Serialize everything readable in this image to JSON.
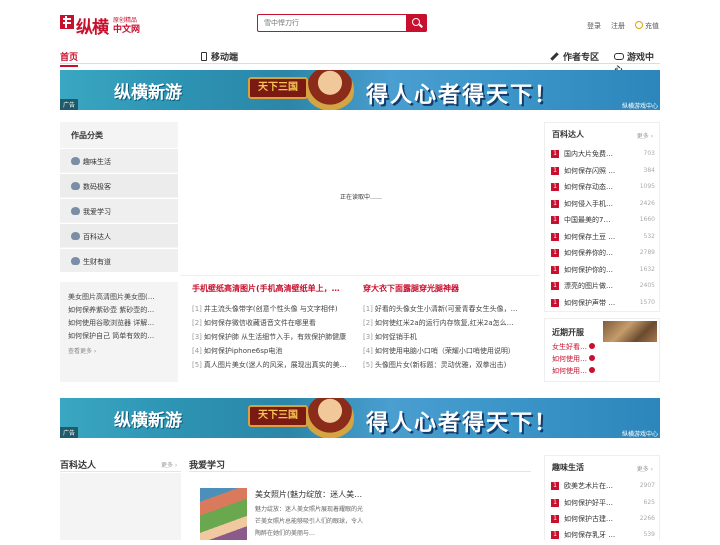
{
  "header": {
    "logo_text": "纵横",
    "logo_sub1": "原创精品",
    "logo_sub2": "中文网",
    "search_placeholder": "雪中悍刀行",
    "login": "登录",
    "register": "注册",
    "recharge": "充值"
  },
  "nav": {
    "home": "首页",
    "mobile": "移动端",
    "author": "作者专区",
    "game": "游戏中心"
  },
  "banner": {
    "brand": "纵横新游",
    "game_logo": "天下三国",
    "slogan": "得人心者得天下！",
    "ad_label": "广告",
    "source": "纵横游戏中心"
  },
  "categories": {
    "title": "作品分类",
    "items": [
      "趣味生活",
      "数码极客",
      "我爱学习",
      "百科达人",
      "生财有道"
    ]
  },
  "left_list": {
    "items": [
      "美女图片高清图片美女图(…",
      "如何保养紫砂壶 紫砂壶的…",
      "如何使用谷歌浏览器 详解…",
      "如何保护自己 简单有效的…"
    ],
    "more": "查看更多 ›"
  },
  "loading_text": "正在读取中……",
  "center_left": {
    "heading": "手机壁纸高清图片(手机高清壁纸单上，…",
    "items": [
      {
        "n": "[1]",
        "t": "井主流头像带字(创意个性头像 与文字相伴)"
      },
      {
        "n": "[2]",
        "t": "如何保存微信收藏语音文件在哪里看"
      },
      {
        "n": "[3]",
        "t": "如何保护肺 从生活细节入手，有效保护肺健康"
      },
      {
        "n": "[4]",
        "t": "如何保护iphone6sp电池"
      },
      {
        "n": "[5]",
        "t": "真人图片美女(迷人的风采，展现出真实的美…"
      }
    ]
  },
  "center_right": {
    "heading": "穿大衣下面露腿穿光腿神器",
    "items": [
      {
        "n": "[1]",
        "t": "好看的头像女生小清新(可爱青春女生头像，…"
      },
      {
        "n": "[2]",
        "t": "如何使红米2a的运行内存恢复,红米2a怎么…"
      },
      {
        "n": "[3]",
        "t": "如何促销手机"
      },
      {
        "n": "[4]",
        "t": "如何使用电脑小口哨（荣耀小口哨使用说明）"
      },
      {
        "n": "[5]",
        "t": "头像图片女(新标题：灵动优雅，双拳出击)"
      }
    ]
  },
  "baike": {
    "title": "百科达人",
    "more": "更多 ›",
    "items": [
      {
        "n": "1",
        "t": "国内大片免费…",
        "c": "703"
      },
      {
        "n": "1",
        "t": "如何保存闪照 …",
        "c": "384"
      },
      {
        "n": "1",
        "t": "如何保存动态…",
        "c": "1095"
      },
      {
        "n": "1",
        "t": "如何侵入手机…",
        "c": "2426"
      },
      {
        "n": "1",
        "t": "中国最美的7…",
        "c": "1660"
      },
      {
        "n": "1",
        "t": "如何保存土豆 …",
        "c": "532"
      },
      {
        "n": "1",
        "t": "如何保养你的…",
        "c": "2789"
      },
      {
        "n": "1",
        "t": "如何保护你的…",
        "c": "1632"
      },
      {
        "n": "1",
        "t": "漂亮的图片做…",
        "c": "2405"
      },
      {
        "n": "1",
        "t": "如何保护声带 …",
        "c": "1570"
      }
    ]
  },
  "recent": {
    "title": "近期开服",
    "items": [
      "女生好看…",
      "如何使用…",
      "如何使用…"
    ]
  },
  "bottom": {
    "baike_title": "百科达人",
    "baike_more": "更多 ›",
    "study_title": "我爱学习",
    "study_item_title": "美女照片(魅力绽放：迷人美…",
    "study_item_desc": "魅力绽放：迷人美女照片展现着耀眼的光芒美女照片总能够吸引人们的眼球，令人陶醉在她们的美丽与…",
    "fun_title": "趣味生活",
    "fun_more": "更多 ›",
    "fun_items": [
      {
        "n": "1",
        "t": "欧美艺术片在…",
        "c": "2907"
      },
      {
        "n": "1",
        "t": "如何保护好平…",
        "c": "625"
      },
      {
        "n": "1",
        "t": "如何保护古建…",
        "c": "2266"
      },
      {
        "n": "1",
        "t": "如何保存乳牙 …",
        "c": "539"
      }
    ]
  }
}
